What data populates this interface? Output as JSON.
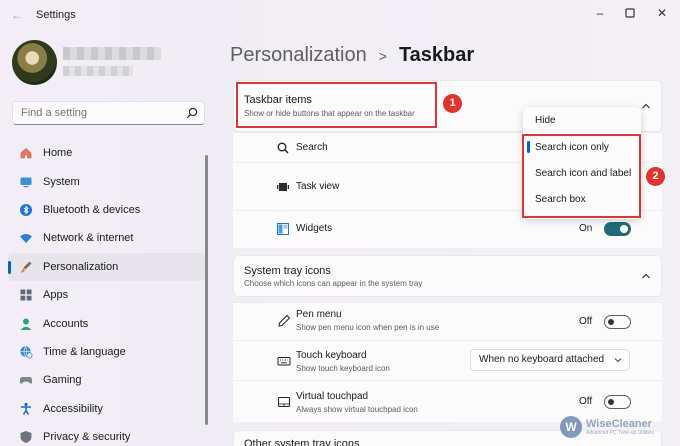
{
  "window": {
    "title": "Settings",
    "back_icon": "back-arrow-icon"
  },
  "search": {
    "placeholder": "Find a setting"
  },
  "sidebar": {
    "items": [
      {
        "label": "Home",
        "icon": "home-icon",
        "active": false
      },
      {
        "label": "System",
        "icon": "system-icon",
        "active": false
      },
      {
        "label": "Bluetooth & devices",
        "icon": "bluetooth-icon",
        "active": false
      },
      {
        "label": "Network & internet",
        "icon": "wifi-icon",
        "active": false
      },
      {
        "label": "Personalization",
        "icon": "brush-icon",
        "active": true
      },
      {
        "label": "Apps",
        "icon": "apps-icon",
        "active": false
      },
      {
        "label": "Accounts",
        "icon": "person-icon",
        "active": false
      },
      {
        "label": "Time & language",
        "icon": "globe-clock-icon",
        "active": false
      },
      {
        "label": "Gaming",
        "icon": "gamepad-icon",
        "active": false
      },
      {
        "label": "Accessibility",
        "icon": "accessibility-icon",
        "active": false
      },
      {
        "label": "Privacy & security",
        "icon": "shield-icon",
        "active": false
      }
    ]
  },
  "breadcrumb": {
    "parent": "Personalization",
    "separator": ">",
    "current": "Taskbar"
  },
  "taskbar_items": {
    "title": "Taskbar items",
    "subtitle": "Show or hide buttons that appear on the taskbar",
    "rows": [
      {
        "label": "Search",
        "icon": "search-icon"
      },
      {
        "label": "Task view",
        "icon": "task-view-icon"
      },
      {
        "label": "Widgets",
        "icon": "widgets-icon",
        "state": "On",
        "toggle_on": true
      }
    ]
  },
  "search_flyout": {
    "options": [
      "Hide",
      "Search icon only",
      "Search icon and label",
      "Search box"
    ],
    "selected": "Search icon only"
  },
  "system_tray": {
    "title": "System tray icons",
    "subtitle": "Choose which icons can appear in the system tray",
    "rows": [
      {
        "label": "Pen menu",
        "sub": "Show pen menu icon when pen is in use",
        "icon": "pen-icon",
        "state": "Off",
        "toggle_on": false
      },
      {
        "label": "Touch keyboard",
        "sub": "Show touch keyboard icon",
        "icon": "keyboard-icon",
        "dropdown": "When no keyboard attached"
      },
      {
        "label": "Virtual touchpad",
        "sub": "Always show virtual touchpad icon",
        "icon": "touchpad-icon",
        "state": "Off",
        "toggle_on": false
      }
    ]
  },
  "other_tray": {
    "title": "Other system tray icons"
  },
  "annotations": {
    "badge1": "1",
    "badge2": "2",
    "color": "#d93838"
  },
  "watermark": {
    "name": "WiseCleaner",
    "tagline": "Advanced PC Tune-up Utilities",
    "logo_letter": "W"
  },
  "accent_color": "#0067c0",
  "toggle_on_color": "#1f6b7a"
}
